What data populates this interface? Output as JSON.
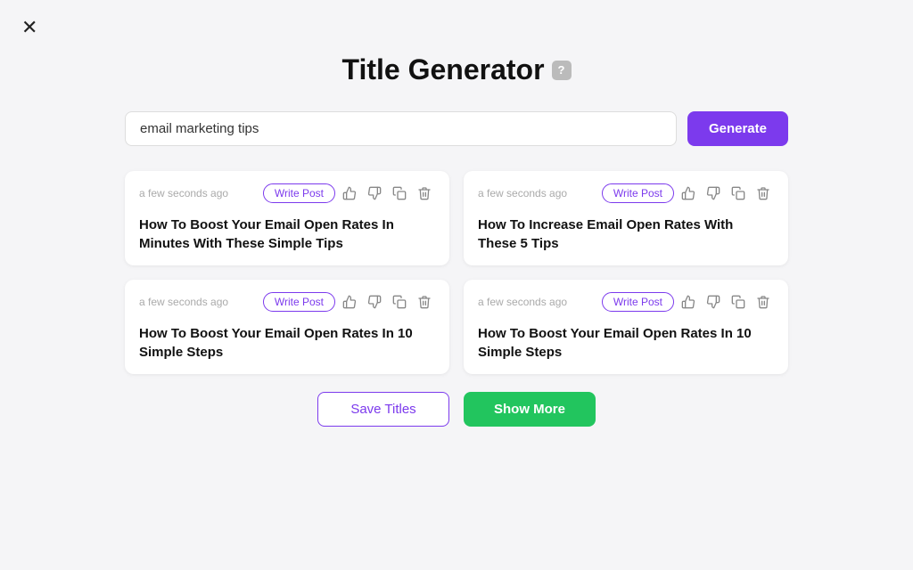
{
  "close": "✕",
  "header": {
    "title": "Title Generator",
    "help_label": "?"
  },
  "search": {
    "placeholder": "email marketing tips",
    "value": "email marketing tips",
    "generate_label": "Generate"
  },
  "cards": [
    {
      "id": 1,
      "meta": "a few seconds ago",
      "write_post_label": "Write Post",
      "title": "How To Boost Your Email Open Rates In Minutes With These Simple Tips"
    },
    {
      "id": 2,
      "meta": "a few seconds ago",
      "write_post_label": "Write Post",
      "title": "How To Increase Email Open Rates With These 5 Tips"
    },
    {
      "id": 3,
      "meta": "a few seconds ago",
      "write_post_label": "Write Post",
      "title": "How To Boost Your Email Open Rates In 10 Simple Steps"
    },
    {
      "id": 4,
      "meta": "a few seconds ago",
      "write_post_label": "Write Post",
      "title": "How To Boost Your Email Open Rates In 10 Simple Steps"
    }
  ],
  "actions": {
    "save_titles_label": "Save Titles",
    "show_more_label": "Show More"
  },
  "icons": {
    "thumbs_up": "👍",
    "thumbs_down": "👎",
    "copy": "⧉",
    "trash": "🗑"
  }
}
